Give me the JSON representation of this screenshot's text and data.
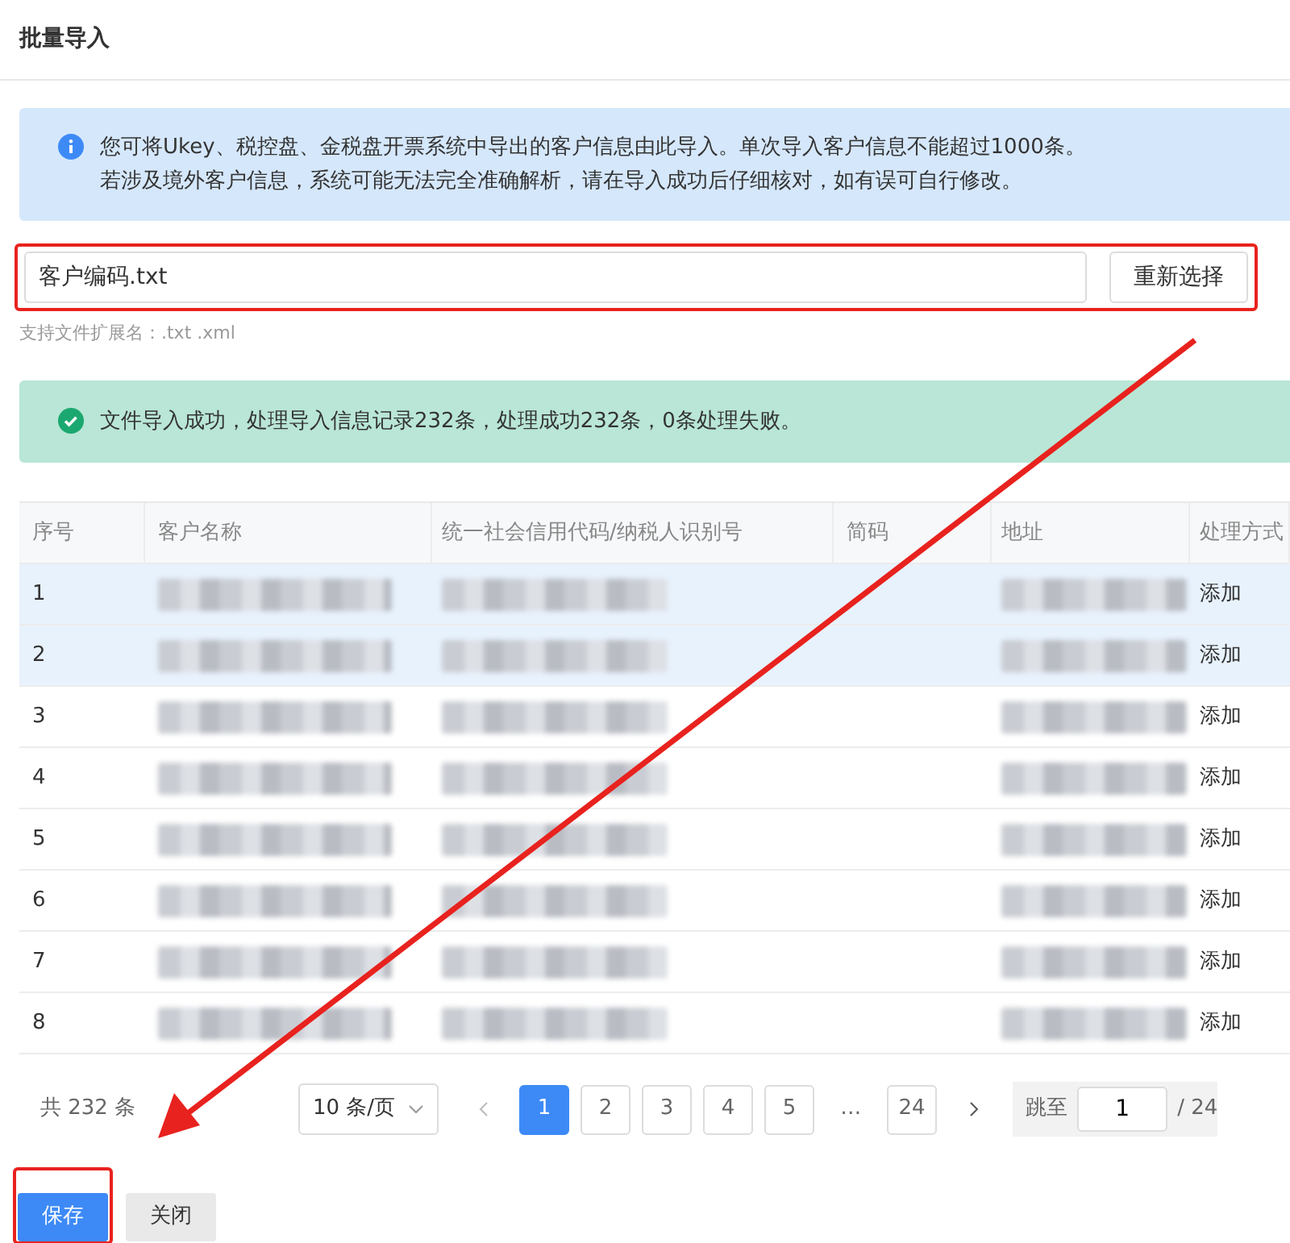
{
  "title": "批量导入",
  "info_alert": {
    "lines": [
      "您可将Ukey、税控盘、金税盘开票系统中导出的客户信息由此导入。单次导入客户信息不能超过1000条。",
      "若涉及境外客户信息，系统可能无法完全准确解析，请在导入成功后仔细核对，如有误可自行修改。"
    ]
  },
  "file": {
    "value": "客户编码.txt",
    "button": "重新选择",
    "hint": "支持文件扩展名：.txt .xml"
  },
  "success_alert": {
    "text": "文件导入成功，处理导入信息记录232条，处理成功232条，0条处理失败。"
  },
  "table": {
    "columns": [
      "序号",
      "客户名称",
      "统一社会信用代码/纳税人识别号",
      "简码",
      "地址",
      "处理方式"
    ],
    "rows": [
      {
        "index": "1",
        "selected": true,
        "cells": [
          {
            "kind": "blurred"
          },
          {
            "kind": "blurred"
          },
          {
            "kind": "blank"
          },
          {
            "kind": "blurred"
          }
        ],
        "action": "添加"
      },
      {
        "index": "2",
        "selected": true,
        "cells": [
          {
            "kind": "blurred"
          },
          {
            "kind": "blurred"
          },
          {
            "kind": "blank"
          },
          {
            "kind": "blurred"
          }
        ],
        "action": "添加"
      },
      {
        "index": "3",
        "selected": false,
        "cells": [
          {
            "kind": "blurred"
          },
          {
            "kind": "blurred"
          },
          {
            "kind": "blank"
          },
          {
            "kind": "blurred"
          }
        ],
        "action": "添加"
      },
      {
        "index": "4",
        "selected": false,
        "cells": [
          {
            "kind": "blurred"
          },
          {
            "kind": "blurred"
          },
          {
            "kind": "blank"
          },
          {
            "kind": "blurred"
          }
        ],
        "action": "添加"
      },
      {
        "index": "5",
        "selected": false,
        "cells": [
          {
            "kind": "blurred"
          },
          {
            "kind": "blurred"
          },
          {
            "kind": "blank"
          },
          {
            "kind": "blurred"
          }
        ],
        "action": "添加"
      },
      {
        "index": "6",
        "selected": false,
        "cells": [
          {
            "kind": "blurred"
          },
          {
            "kind": "blurred"
          },
          {
            "kind": "blank"
          },
          {
            "kind": "blurred"
          }
        ],
        "action": "添加"
      },
      {
        "index": "7",
        "selected": false,
        "cells": [
          {
            "kind": "blurred"
          },
          {
            "kind": "blurred"
          },
          {
            "kind": "blank"
          },
          {
            "kind": "blurred"
          }
        ],
        "action": "添加"
      },
      {
        "index": "8",
        "selected": false,
        "cells": [
          {
            "kind": "blurred"
          },
          {
            "kind": "blurred"
          },
          {
            "kind": "blank"
          },
          {
            "kind": "blurred"
          }
        ],
        "action": "添加"
      }
    ]
  },
  "pagination": {
    "total": "共 232 条",
    "page_size": "10 条/页",
    "pages": [
      {
        "label": "1",
        "selected": true
      },
      {
        "label": "2",
        "selected": false
      },
      {
        "label": "3",
        "selected": false
      },
      {
        "label": "4",
        "selected": false
      },
      {
        "label": "5",
        "selected": false
      },
      {
        "label": "…",
        "kind": "ellipsis"
      },
      {
        "label": "24",
        "selected": false
      }
    ],
    "jump_label": "跳至",
    "jump_value": "1",
    "page_count": "/ 24"
  },
  "buttons": [
    {
      "label": "保存",
      "kind": "primary"
    },
    {
      "label": "关闭",
      "kind": "secondary"
    }
  ],
  "annotations": {
    "file_frame": true,
    "save_frame": true,
    "arrow": true
  }
}
